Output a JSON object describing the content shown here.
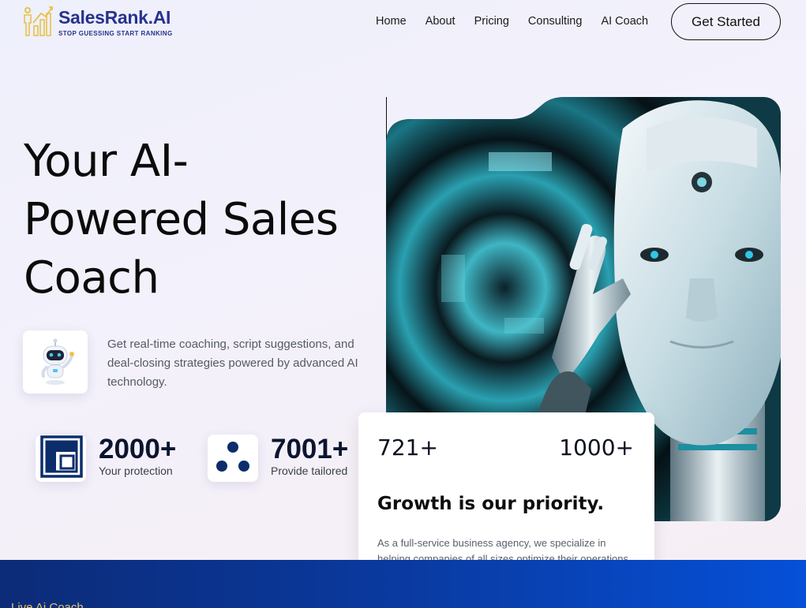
{
  "header": {
    "brand": "SalesRank.AI",
    "tagline": "STOP GUESSING START RANKING",
    "nav": [
      {
        "label": "Home"
      },
      {
        "label": "About"
      },
      {
        "label": "Pricing"
      },
      {
        "label": "Consulting"
      },
      {
        "label": "AI Coach"
      }
    ],
    "cta_label": "Get Started",
    "brand_color": "#27338d",
    "logo_accent": "#e8c24a"
  },
  "hero": {
    "title": "Your AI-Powered Sales Coach",
    "description": "Get real-time coaching, script suggestions, and deal-closing strategies powered by advanced AI technology."
  },
  "stats": [
    {
      "value": "2000+",
      "label": "Your protection",
      "icon": "layout-icon"
    },
    {
      "value": "7001+",
      "label": "Provide tailored",
      "icon": "dots-icon"
    }
  ],
  "card": {
    "stat_left": "721+",
    "stat_right": "1000+",
    "title": "Growth is our priority.",
    "description": "As a full-service business agency, we specialize in helping companies of all sizes optimize their operations"
  },
  "band": {
    "label": "Live Ai Coach"
  },
  "colors": {
    "accent_dark": "#0c2d6b",
    "band_start": "#0c2b78",
    "band_end": "#0550d8"
  }
}
